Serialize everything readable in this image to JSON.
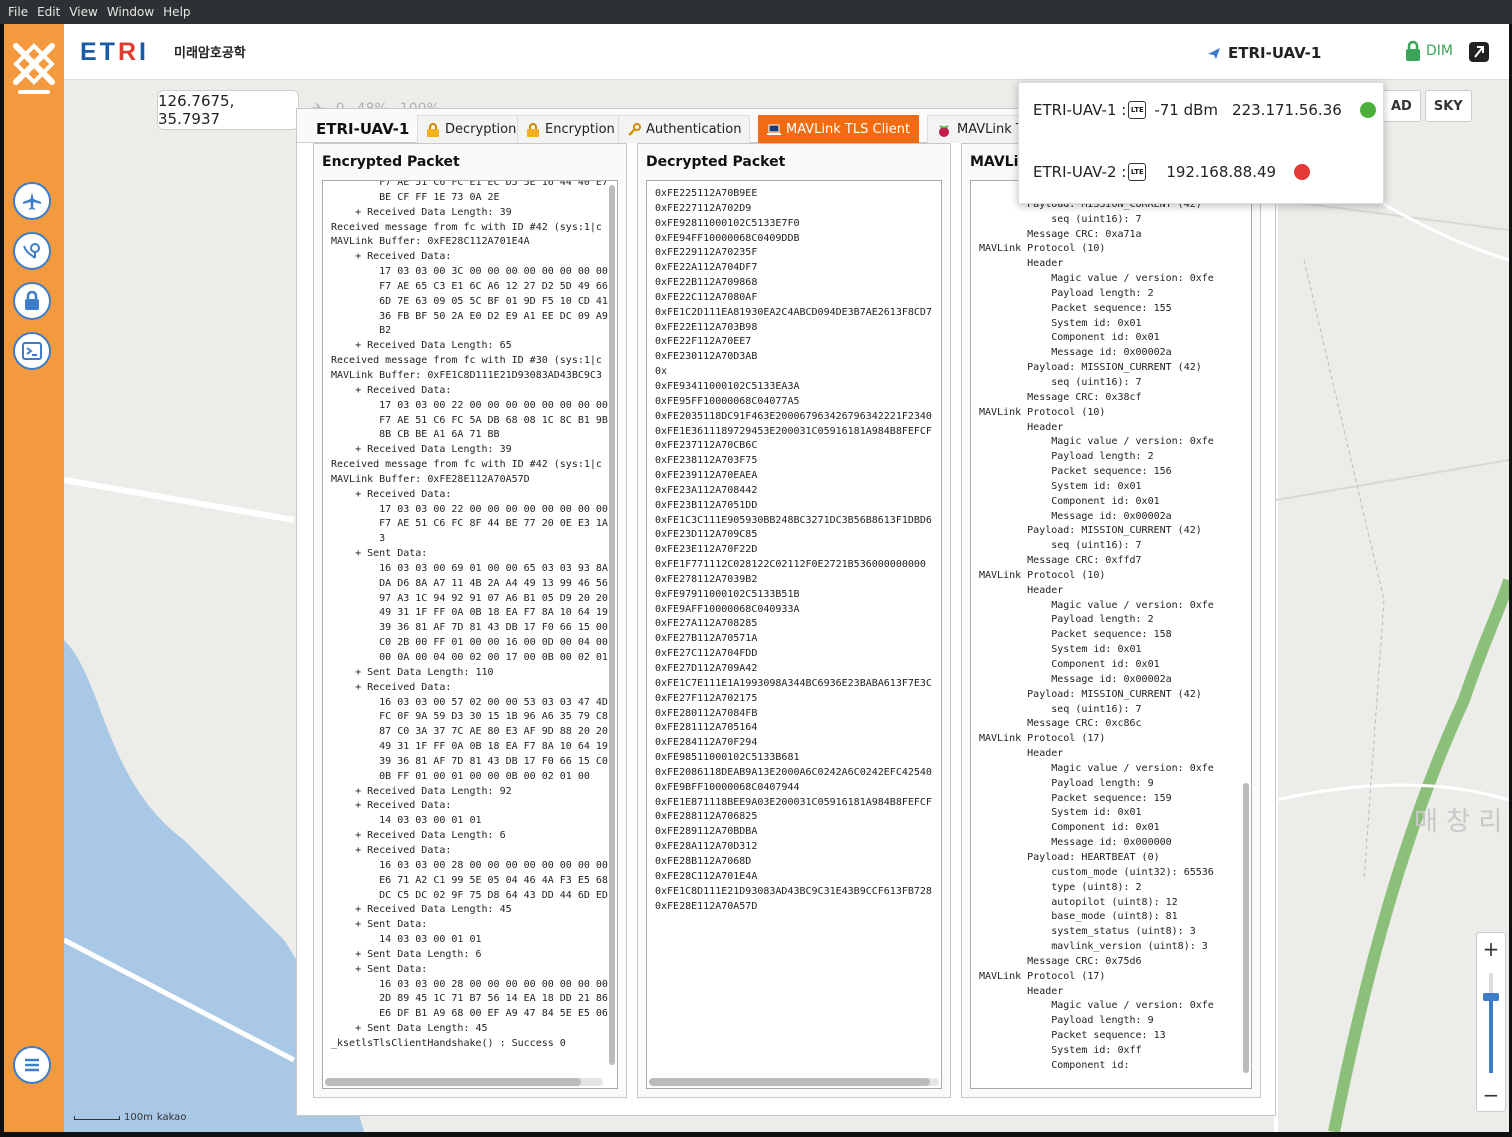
{
  "menubar": {
    "items": [
      "File",
      "Edit",
      "View",
      "Window",
      "Help"
    ]
  },
  "header": {
    "brand": "ETRI",
    "brand_sub": "미래암호공학",
    "uav_title": "ETRI-UAV-1",
    "dim_label": "DIM"
  },
  "map": {
    "coordinates": "126.7675, 35.7937",
    "status": {
      "count": "0",
      "percent_a": "48%",
      "percent_b": "100%"
    },
    "map_types": [
      "AD",
      "SKY"
    ],
    "place_label": "매 창 리",
    "scale_label": "100m",
    "provider": "kakao",
    "zoom": {
      "plus": "+",
      "minus": "−"
    }
  },
  "panel": {
    "uav_label": "ETRI-UAV-1",
    "tabs": [
      {
        "label": "Decryption",
        "icon": "lock-icon",
        "active": false
      },
      {
        "label": "Encryption",
        "icon": "lock-icon",
        "active": false
      },
      {
        "label": "Authentication",
        "icon": "key-icon",
        "active": false
      },
      {
        "label": "MAVLink TLS Client",
        "icon": "laptop-icon",
        "active": true
      },
      {
        "label": "MAVLink T",
        "icon": "raspberry-icon",
        "active": false
      }
    ],
    "columns": {
      "encrypted": {
        "title": "Encrypted Packet",
        "text": "        F7 AE 51 C6 FC E1 EC D5 5E 16 44 40 E7\n        BE CF FF 1E 73 0A 2E\n    + Received Data Length: 39\nReceived message from fc with ID #42 (sys:1|c\nMAVLink Buffer: 0xFE28C112A701E4A\n    + Received Data:\n        17 03 03 00 3C 00 00 00 00 00 00 00 00\n        F7 AE 65 C3 E1 6C A6 12 27 D2 5D 49 66\n        6D 7E 63 09 05 5C BF 01 9D F5 10 CD 41\n        36 FB BF 50 2A E0 D2 E9 A1 EE DC 09 A9\n        B2\n    + Received Data Length: 65\nReceived message from fc with ID #30 (sys:1|c\nMAVLink Buffer: 0xFE1C8D111E21D93083AD43BC9C3\n    + Received Data:\n        17 03 03 00 22 00 00 00 00 00 00 00 00\n        F7 AE 51 C6 FC 5A DB 68 08 1C 8C B1 9B\n        8B CB BE A1 6A 71 BB\n    + Received Data Length: 39\nReceived message from fc with ID #42 (sys:1|c\nMAVLink Buffer: 0xFE28E112A70A57D\n    + Received Data:\n        17 03 03 00 22 00 00 00 00 00 00 00 00\n        F7 AE 51 C6 FC 8F 44 BE 77 20 0E E3 1A\n        3\n    + Sent Data:\n        16 03 03 00 69 01 00 00 65 03 03 93 8A\n        DA D6 8A A7 11 4B 2A A4 49 13 99 46 56\n        97 A3 1C 94 92 91 07 A6 B1 05 D9 20 20\n        49 31 1F FF 0A 0B 18 EA F7 8A 10 64 19\n        39 36 81 AF 7D 81 43 DB 17 F0 66 15 00\n        C0 2B 00 FF 01 00 00 16 00 0D 00 04 00\n        00 0A 00 04 00 02 00 17 00 0B 00 02 01\n    + Sent Data Length: 110\n    + Received Data:\n        16 03 03 00 57 02 00 00 53 03 03 47 4D\n        FC 0F 9A 59 D3 30 15 1B 96 A6 35 79 C8\n        87 C0 3A 37 7C AE 80 E3 AF 9D 88 20 20\n        49 31 1F FF 0A 0B 18 EA F7 8A 10 64 19\n        39 36 81 AF 7D 81 43 DB 17 F0 66 15 C0\n        0B FF 01 00 01 00 00 0B 00 02 01 00\n    + Received Data Length: 92\n    + Received Data:\n        14 03 03 00 01 01\n    + Received Data Length: 6\n    + Received Data:\n        16 03 03 00 28 00 00 00 00 00 00 00 00\n        E6 71 A2 C1 99 5E 05 04 46 4A F3 E5 68\n        DC C5 DC 02 9F 75 D8 64 43 DD 44 6D ED\n    + Received Data Length: 45\n    + Sent Data:\n        14 03 03 00 01 01\n    + Sent Data Length: 6\n    + Sent Data:\n        16 03 03 00 28 00 00 00 00 00 00 00 00\n        2D 89 45 1C 71 B7 56 14 EA 18 DD 21 86\n        E6 DF B1 A9 68 00 EF A9 47 84 5E E5 06\n    + Sent Data Length: 45\n_ksetlsTlsClientHandshake() : Success 0"
      },
      "decrypted": {
        "title": "Decrypted Packet",
        "text": "0xFE225112A70B9EE\n0xFE227112A702D9\n0xFE92811000102C5133E7F0\n0xFE94FF10000068C0409DDB\n0xFE229112A70235F\n0xFE22A112A704DF7\n0xFE22B112A709868\n0xFE22C112A7080AF\n0xFE1C2D111EA81930EA2C4ABCD094DE3B7AE2613F8CD7\n0xFE22E112A703B98\n0xFE22F112A70EE7\n0xFE230112A70D3AB\n0x\n0xFE93411000102C5133EA3A\n0xFE95FF10000068C04077A5\n0xFE2035118DC91F463E200067963426796342221F2340\n0xFE1E3611189729453E200031C05916181A984B8FEFCF\n0xFE237112A70CB6C\n0xFE238112A703F75\n0xFE239112A70EAEA\n0xFE23A112A708442\n0xFE23B112A7051DD\n0xFE1C3C111E905930BB248BC3271DC3B56B8613F1DBD6\n0xFE23D112A709C85\n0xFE23E112A70F22D\n0xFE1F771112C028122C02112F0E2721B536000000000\n0xFE278112A7039B2\n0xFE97911000102C5133B51B\n0xFE9AFF10000068C040933A\n0xFE27A112A708285\n0xFE27B112A70571A\n0xFE27C112A704FDD\n0xFE27D112A709A42\n0xFE1C7E111E1A1993098A344BC6936E23BABA613F7E3C\n0xFE27F112A702175\n0xFE280112A7084FB\n0xFE281112A705164\n0xFE284112A70F294\n0xFE98511000102C5133B681\n0xFE2086118DEAB9A13E2000A6C0242A6C0242EFC42540\n0xFE9BFF10000068C0407944\n0xFE1E871118BEE9A03E200031C05916181A984B8FEFCF\n0xFE288112A706825\n0xFE289112A70BDBA\n0xFE28A112A70D312\n0xFE28B112A7068D\n0xFE28C112A701E4A\n0xFE1C8D111E21D93083AD43BC9C31E43B9CCF613FB728\n0xFE28E112A70A57D"
      },
      "mavlink": {
        "title": "MAVLin",
        "text": "                Message id: 0x00002a\n        Payload: MISSION_CURRENT (42)\n            seq (uint16): 7\n        Message CRC: 0xa71a\nMAVLink Protocol (10)\n        Header\n            Magic value / version: 0xfe\n            Payload length: 2\n            Packet sequence: 155\n            System id: 0x01\n            Component id: 0x01\n            Message id: 0x00002a\n        Payload: MISSION_CURRENT (42)\n            seq (uint16): 7\n        Message CRC: 0x38cf\nMAVLink Protocol (10)\n        Header\n            Magic value / version: 0xfe\n            Payload length: 2\n            Packet sequence: 156\n            System id: 0x01\n            Component id: 0x01\n            Message id: 0x00002a\n        Payload: MISSION_CURRENT (42)\n            seq (uint16): 7\n        Message CRC: 0xffd7\nMAVLink Protocol (10)\n        Header\n            Magic value / version: 0xfe\n            Payload length: 2\n            Packet sequence: 158\n            System id: 0x01\n            Component id: 0x01\n            Message id: 0x00002a\n        Payload: MISSION_CURRENT (42)\n            seq (uint16): 7\n        Message CRC: 0xc86c\nMAVLink Protocol (17)\n        Header\n            Magic value / version: 0xfe\n            Payload length: 9\n            Packet sequence: 159\n            System id: 0x01\n            Component id: 0x01\n            Message id: 0x000000\n        Payload: HEARTBEAT (0)\n            custom_mode (uint32): 65536\n            type (uint8): 2\n            autopilot (uint8): 12\n            base_mode (uint8): 81\n            system_status (uint8): 3\n            mavlink_version (uint8): 3\n        Message CRC: 0x75d6\nMAVLink Protocol (17)\n        Header\n            Magic value / version: 0xfe\n            Payload length: 9\n            Packet sequence: 13\n            System id: 0xff\n            Component id:"
      }
    }
  },
  "connection_popup": {
    "rows": [
      {
        "name": "ETRI-UAV-1 :",
        "signal": "-71 dBm",
        "ip": "223.171.56.36",
        "status_color": "#4caf3a"
      },
      {
        "name": "ETRI-UAV-2 :",
        "signal": "",
        "ip": "192.168.88.49",
        "status_color": "#e53935"
      }
    ],
    "lte_label": "LTE"
  },
  "colors": {
    "sidebar": "#f39a3e",
    "brand_blue": "#1a5ba6",
    "brand_red": "#e03c31",
    "active_tab": "#f26b10",
    "accent_blue": "#3d7cc9"
  }
}
